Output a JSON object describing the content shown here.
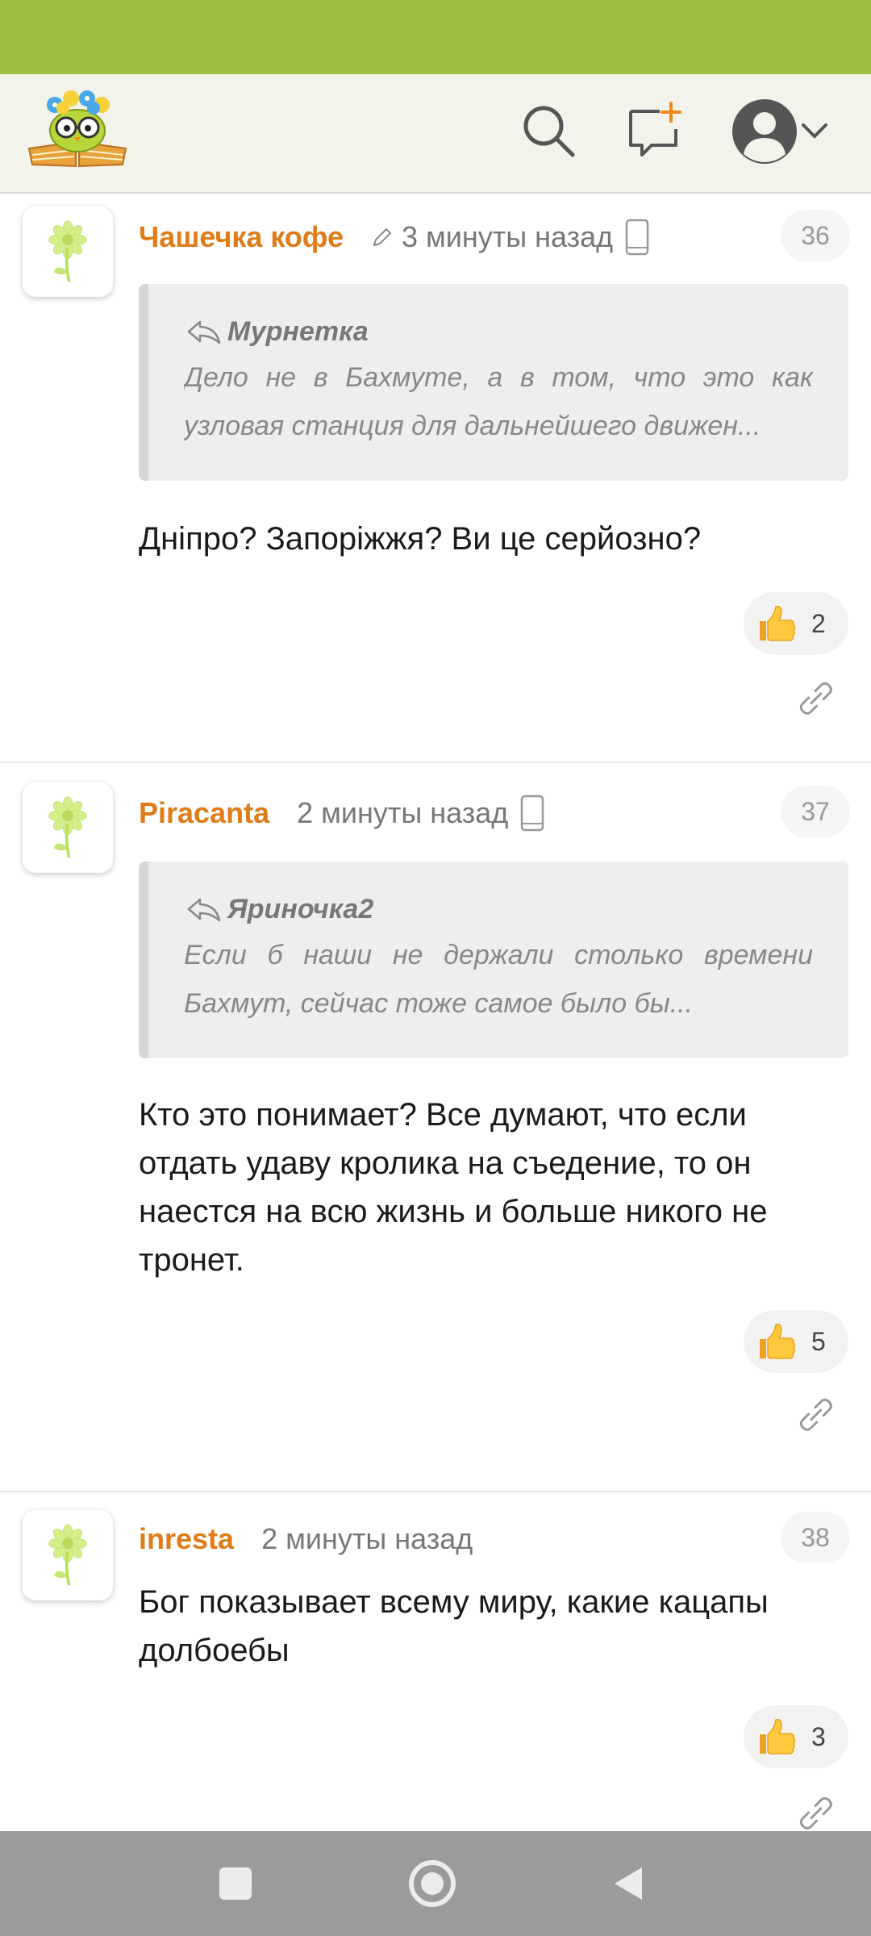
{
  "comments": [
    {
      "author": "Чашечка кофе",
      "time": "3 минуты назад",
      "number": "36",
      "quote": {
        "author": "Мурнетка",
        "text": "Дело не в Бахмуте, а в том, что это как узловая станция для дальнейшего движен..."
      },
      "text": "Дніпро? Запоріжжя? Ви це серйозно?",
      "likes": "2"
    },
    {
      "author": "Piracanta",
      "time": "2 минуты назад",
      "number": "37",
      "quote": {
        "author": "Яриночка2",
        "text": "Если б наши не держали столько времени Бахмут, сейчас тоже самое было бы..."
      },
      "text": "Кто это понимает? Все думают, что если отдать удаву кролика на съедение, то он наестся на всю жизнь и больше никого не тронет.",
      "likes": "5"
    },
    {
      "author": "inresta",
      "time": "2 минуты назад",
      "number": "38",
      "text": "Бог показывает всему миру, какие кацапы долбоебы",
      "likes": "3"
    }
  ],
  "colors": {
    "status_bar": "#9bc044",
    "author": "#e07b16",
    "header_bg": "#f3f3ec",
    "nav_bar": "#9b9b9b"
  },
  "icons": {
    "header": [
      "logo-owl-icon",
      "search-icon",
      "new-post-icon",
      "profile-avatar-icon",
      "chevron-down-icon"
    ],
    "comment": [
      "flower-avatar-icon",
      "pencil-icon",
      "phone-icon",
      "reply-icon",
      "thumbs-up-icon",
      "link-icon"
    ],
    "nav": [
      "recent-apps-icon",
      "home-icon",
      "back-icon"
    ]
  }
}
